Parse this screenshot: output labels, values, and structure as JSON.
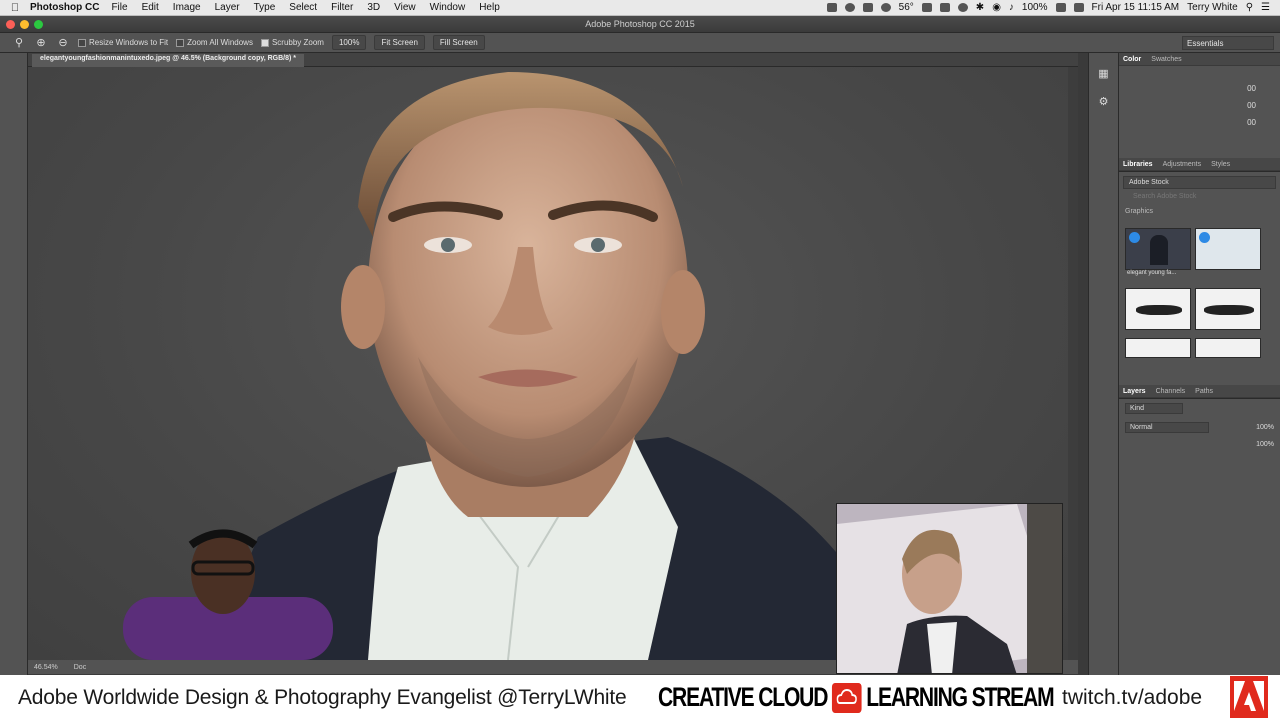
{
  "menubar": {
    "app_name": "Photoshop CC",
    "menus": [
      "File",
      "Edit",
      "Image",
      "Layer",
      "Type",
      "Select",
      "Filter",
      "3D",
      "View",
      "Window",
      "Help"
    ],
    "temperature": "56°",
    "battery": "100%",
    "clock": "Fri Apr 15  11:15 AM",
    "user": "Terry White"
  },
  "window": {
    "title": "Adobe Photoshop CC 2015"
  },
  "options": {
    "resize_windows": "Resize Windows to Fit",
    "zoom_all": "Zoom All Windows",
    "scrubby_zoom": "Scrubby Zoom",
    "zoom_100": "100%",
    "fit_screen": "Fit Screen",
    "fill_screen": "Fill Screen",
    "workspace": "Essentials"
  },
  "document": {
    "tab_label": "elegantyoungfashionmanintuxedo.jpeg @ 46.5% (Background copy, RGB/8) *",
    "zoom_readout": "46.54%",
    "doc_info": "Doc"
  },
  "panels": {
    "color_tabs": [
      "Color",
      "Swatches"
    ],
    "color_values": [
      "00",
      "00",
      "00"
    ],
    "library_tabs": [
      "Libraries",
      "Adjustments",
      "Styles"
    ],
    "library_name": "Adobe Stock",
    "library_search_placeholder": "Search Adobe Stock",
    "graphics_label": "Graphics",
    "thumb_caption": "elegant young fa...",
    "layers_tabs": [
      "Layers",
      "Channels",
      "Paths"
    ],
    "layers_kind": "Kind",
    "blend_mode": "Normal",
    "opacity": "100%",
    "fill": "100%"
  },
  "banner": {
    "evangelist": "Adobe Worldwide Design & Photography Evangelist @TerryLWhite",
    "cc_left": "CREATIVE CLOUD",
    "cc_right": "LEARNING STREAM",
    "url": "twitch.tv/adobe"
  },
  "colors": {
    "adobe_red": "#e02a1d",
    "ps_panel": "#535353",
    "canvas_bg": "#474747"
  }
}
